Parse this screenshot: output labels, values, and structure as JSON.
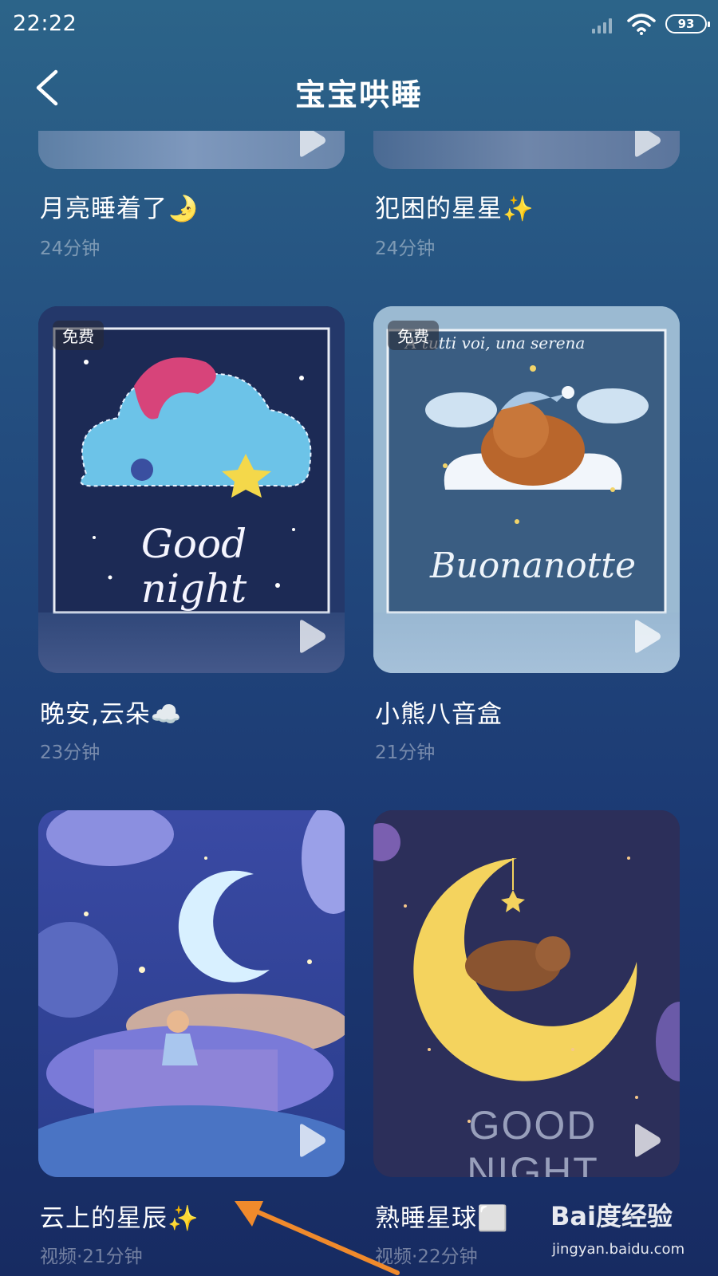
{
  "status_bar": {
    "time": "22:22",
    "battery": "93"
  },
  "header": {
    "title": "宝宝哄睡"
  },
  "cards": [
    {
      "title": "月亮睡着了🌛",
      "subtitle": "24分钟"
    },
    {
      "title": "犯困的星星✨",
      "subtitle": "24分钟"
    },
    {
      "title": "晚安,云朵☁️",
      "subtitle": "23分钟",
      "badge": "免费",
      "art_text": "Good night"
    },
    {
      "title": "小熊八音盒",
      "subtitle": "21分钟",
      "badge": "免费",
      "art_text_top": "A tutti voi, una serena",
      "art_text": "Buonanotte"
    },
    {
      "title": "云上的星辰✨",
      "subtitle": "视频·21分钟"
    },
    {
      "title": "熟睡星球⬜",
      "subtitle": "视频·22分钟",
      "art_text": "GOOD NIGHT"
    }
  ],
  "watermark": {
    "brand": "Bai度经验",
    "url": "jingyan.baidu.com"
  }
}
